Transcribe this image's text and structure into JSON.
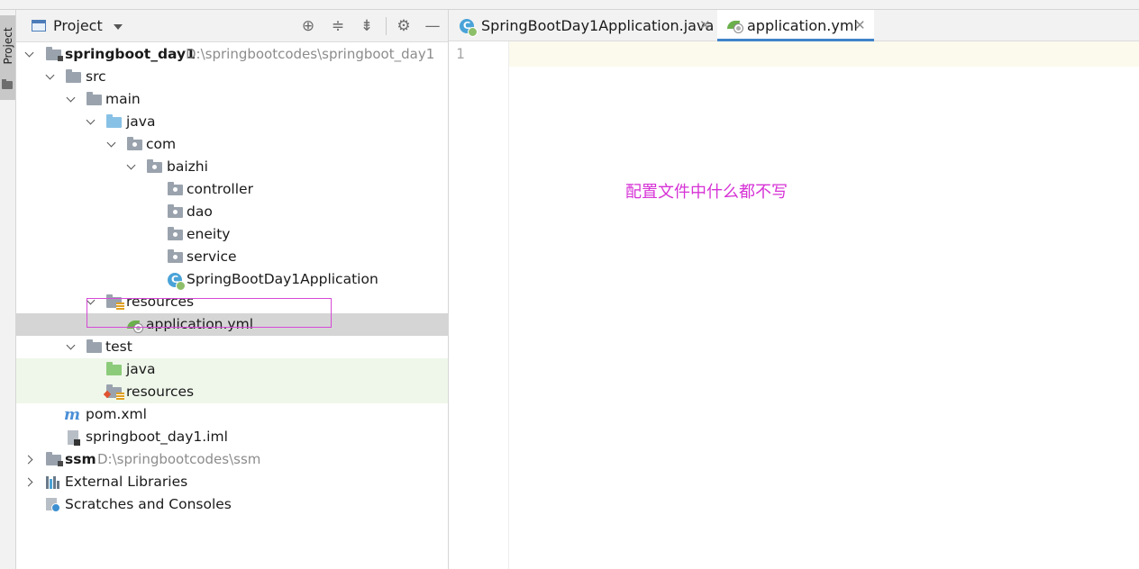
{
  "panel": {
    "title": "Project"
  },
  "tree": {
    "root": {
      "label": "springboot_day1",
      "path": "D:\\springbootcodes\\springboot_day1"
    },
    "src": "src",
    "main": "main",
    "java": "java",
    "com": "com",
    "baizhi": "baizhi",
    "controller": "controller",
    "dao": "dao",
    "eneity": "eneity",
    "service": "service",
    "app_class": "SpringBootDay1Application",
    "resources": "resources",
    "application_yml": "application.yml",
    "test": "test",
    "test_java": "java",
    "test_resources": "resources",
    "pom": "pom.xml",
    "iml": "springboot_day1.iml",
    "ssm": {
      "label": "ssm",
      "path": "D:\\springbootcodes\\ssm"
    },
    "external_libraries": "External Libraries",
    "scratches": "Scratches and Consoles"
  },
  "tabs": [
    {
      "label": "SpringBootDay1Application.java",
      "active": false
    },
    {
      "label": "application.yml",
      "active": true
    }
  ],
  "editor": {
    "line_numbers": [
      "1"
    ],
    "annotation": "配置文件中什么都不写"
  },
  "colors": {
    "accent": "#4083c9",
    "annotation": "#d632d6",
    "highlight_box": "#d64ad6",
    "selection": "#d5d5d5",
    "test_background": "#eff7ea"
  }
}
